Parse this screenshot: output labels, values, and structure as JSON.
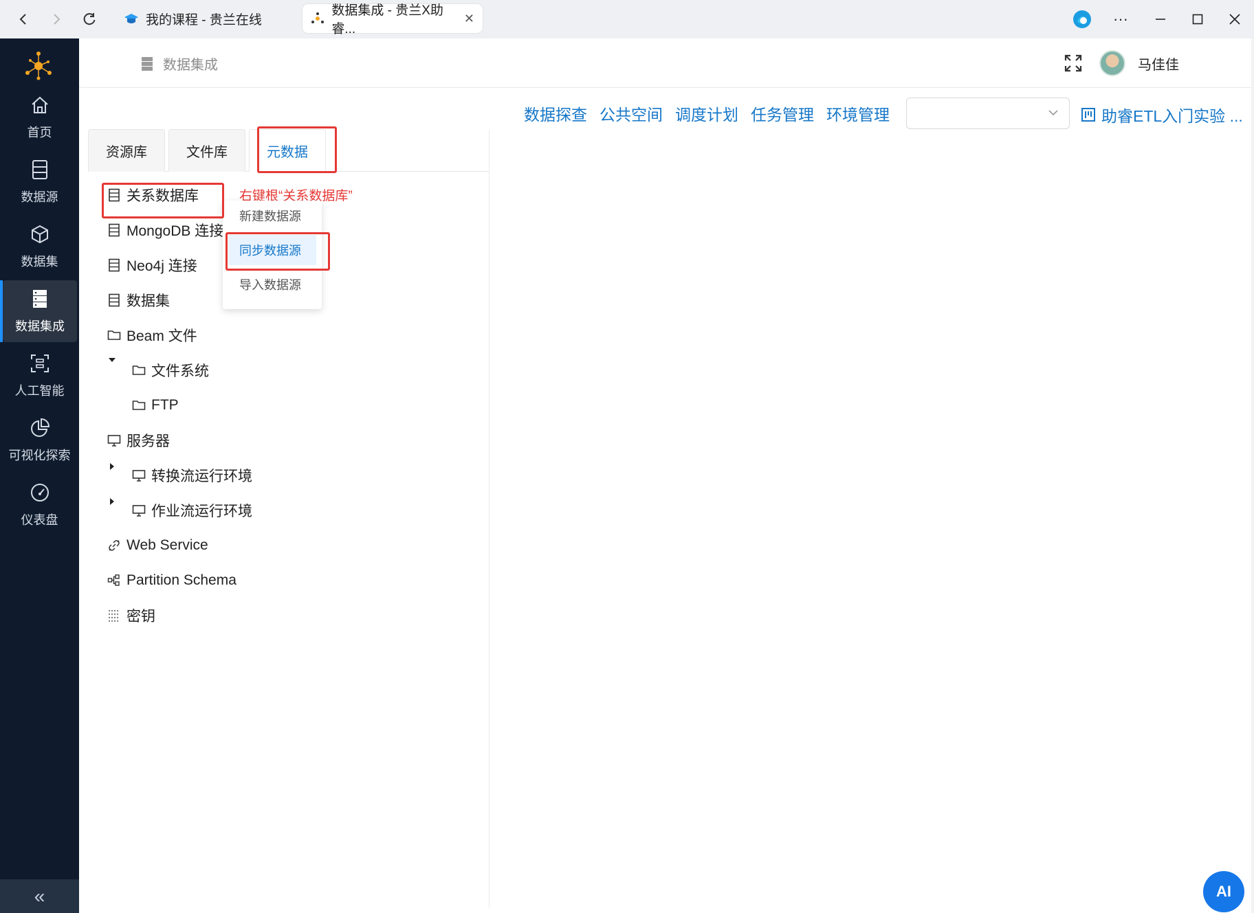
{
  "browser": {
    "tabs": [
      {
        "title": "我的课程 - 贵兰在线",
        "active": false
      },
      {
        "title": "数据集成 - 贵兰X助睿...",
        "active": true
      }
    ],
    "more_label": "···"
  },
  "sidebar": {
    "items": [
      {
        "label": "首页",
        "icon": "home-icon"
      },
      {
        "label": "数据源",
        "icon": "database-icon"
      },
      {
        "label": "数据集",
        "icon": "cube-icon"
      },
      {
        "label": "数据集成",
        "icon": "server-icon",
        "active": true
      },
      {
        "label": "人工智能",
        "icon": "ai-scan-icon"
      },
      {
        "label": "可视化探索",
        "icon": "pie-chart-icon"
      },
      {
        "label": "仪表盘",
        "icon": "gauge-icon"
      }
    ],
    "collapse_label": "«"
  },
  "header": {
    "breadcrumb": "数据集成",
    "username": "马佳佳"
  },
  "toolbar": {
    "links": [
      "数据探查",
      "公共空间",
      "调度计划",
      "任务管理",
      "环境管理"
    ],
    "select_value": "",
    "lab_link": "助睿ETL入门实验 ..."
  },
  "panel": {
    "tabs": [
      "资源库",
      "文件库",
      "元数据"
    ],
    "active_tab": "元数据",
    "tree": [
      {
        "label": "关系数据库",
        "icon": "database-icon"
      },
      {
        "label": "MongoDB 连接",
        "icon": "database-icon"
      },
      {
        "label": "Neo4j 连接",
        "icon": "database-icon"
      },
      {
        "label": "数据集",
        "icon": "database-icon"
      },
      {
        "label": "Beam 文件",
        "icon": "folder-icon"
      },
      {
        "label": "文件系统",
        "icon": "folder-icon",
        "expanded": true
      },
      {
        "label": "FTP",
        "icon": "folder-icon"
      },
      {
        "label": "服务器",
        "icon": "monitor-icon"
      },
      {
        "label": "转换流运行环境",
        "icon": "monitor-icon",
        "collapsed": true
      },
      {
        "label": "作业流运行环境",
        "icon": "monitor-icon",
        "collapsed": true
      },
      {
        "label": "Web Service",
        "icon": "link-icon"
      },
      {
        "label": "Partition Schema",
        "icon": "partition-icon"
      },
      {
        "label": "密钥",
        "icon": "key-grid-icon"
      }
    ]
  },
  "context_menu": {
    "annotation": "右键根“关系数据库”",
    "items": [
      "新建数据源",
      "同步数据源",
      "导入数据源"
    ],
    "highlighted": "同步数据源"
  },
  "ai_button": "AI",
  "colors": {
    "accent": "#1677c8",
    "sidebar": "#0f1b2d",
    "annotation": "#e53935"
  }
}
